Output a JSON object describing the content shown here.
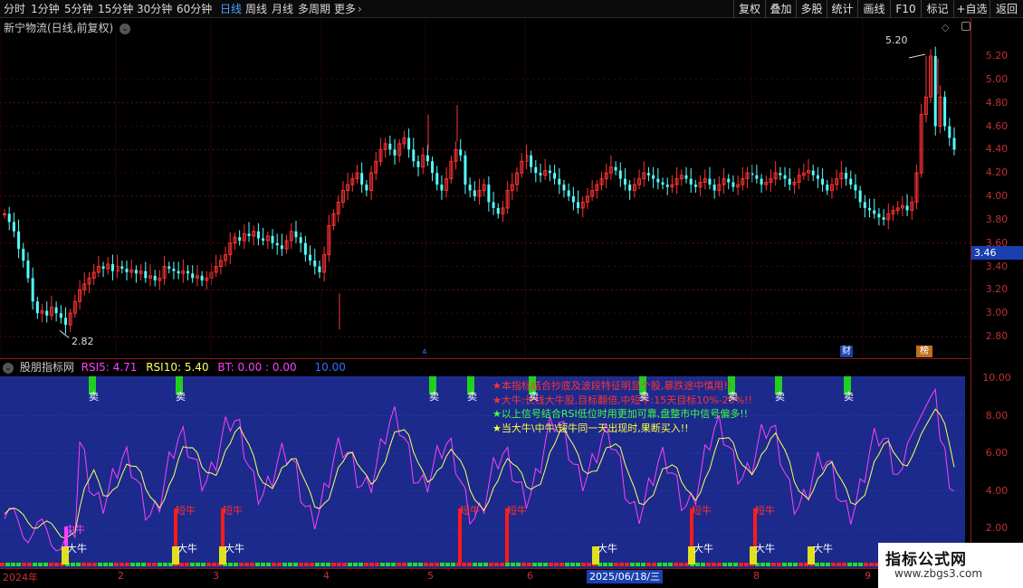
{
  "toolbar": {
    "periods": [
      "分时",
      "1分钟",
      "5分钟",
      "15分钟",
      "30分钟",
      "60分钟",
      "日线",
      "周线",
      "月线",
      "多周期",
      "更多"
    ],
    "more_arrow": "›",
    "right_buttons": [
      "复权",
      "叠加",
      "多股",
      "统计",
      "画线",
      "F10",
      "标记",
      "+自选",
      "返回"
    ]
  },
  "stock": {
    "title": "新宁物流(日线,前复权)",
    "high_label": "5.20",
    "low_label": "2.82",
    "current_price": "3.46"
  },
  "price_axis": [
    "5.20",
    "5.00",
    "4.80",
    "4.60",
    "4.40",
    "4.20",
    "4.00",
    "3.80",
    "3.60",
    "3.40",
    "3.20",
    "3.00",
    "2.80"
  ],
  "event_markers": {
    "cai": "财",
    "bang": "榜"
  },
  "indicator": {
    "name": "股朋指标网",
    "rsi5_label": "RSI5:",
    "rsi5_value": "4.71",
    "rsi10_label": "RSI10:",
    "rsi10_value": "5.40",
    "bt_label": "BT:",
    "bt_value": "0.00",
    "bt_value2": ": 0.00",
    "extra_value": "10.00"
  },
  "indicator_axis": [
    "10.00",
    "8.00",
    "6.00",
    "4.00",
    "2.00"
  ],
  "notes": [
    "★本指标结合抄底及波段特征明显个股,暴跌途中慎用!!",
    "★大牛:长线大牛股,目标翻倍,中短牛:15天目标10%-20%!!",
    "★以上信号结合RSI低位时用更加可靠,盘整市中信号偏多!!",
    "★当大牛\\中牛\\短牛同一天出现时,果断买入!!"
  ],
  "signals": {
    "sell": "卖",
    "big_bull": "大牛",
    "short_bull": "短牛",
    "mid_bull": "中牛"
  },
  "x_axis": {
    "labels": [
      "2024年",
      "2",
      "3",
      "4",
      "5",
      "6",
      "8",
      "9"
    ],
    "cursor_date": "2025/06/18/三"
  },
  "watermark": {
    "title": "指标公式网",
    "url": "www.zbgs3.com"
  },
  "colors": {
    "up": "#ff3333",
    "down": "#54ffff",
    "rsi5": "#ff40ff",
    "rsi10": "#ffff60",
    "indicator_bg": "#1c2a8c"
  }
}
